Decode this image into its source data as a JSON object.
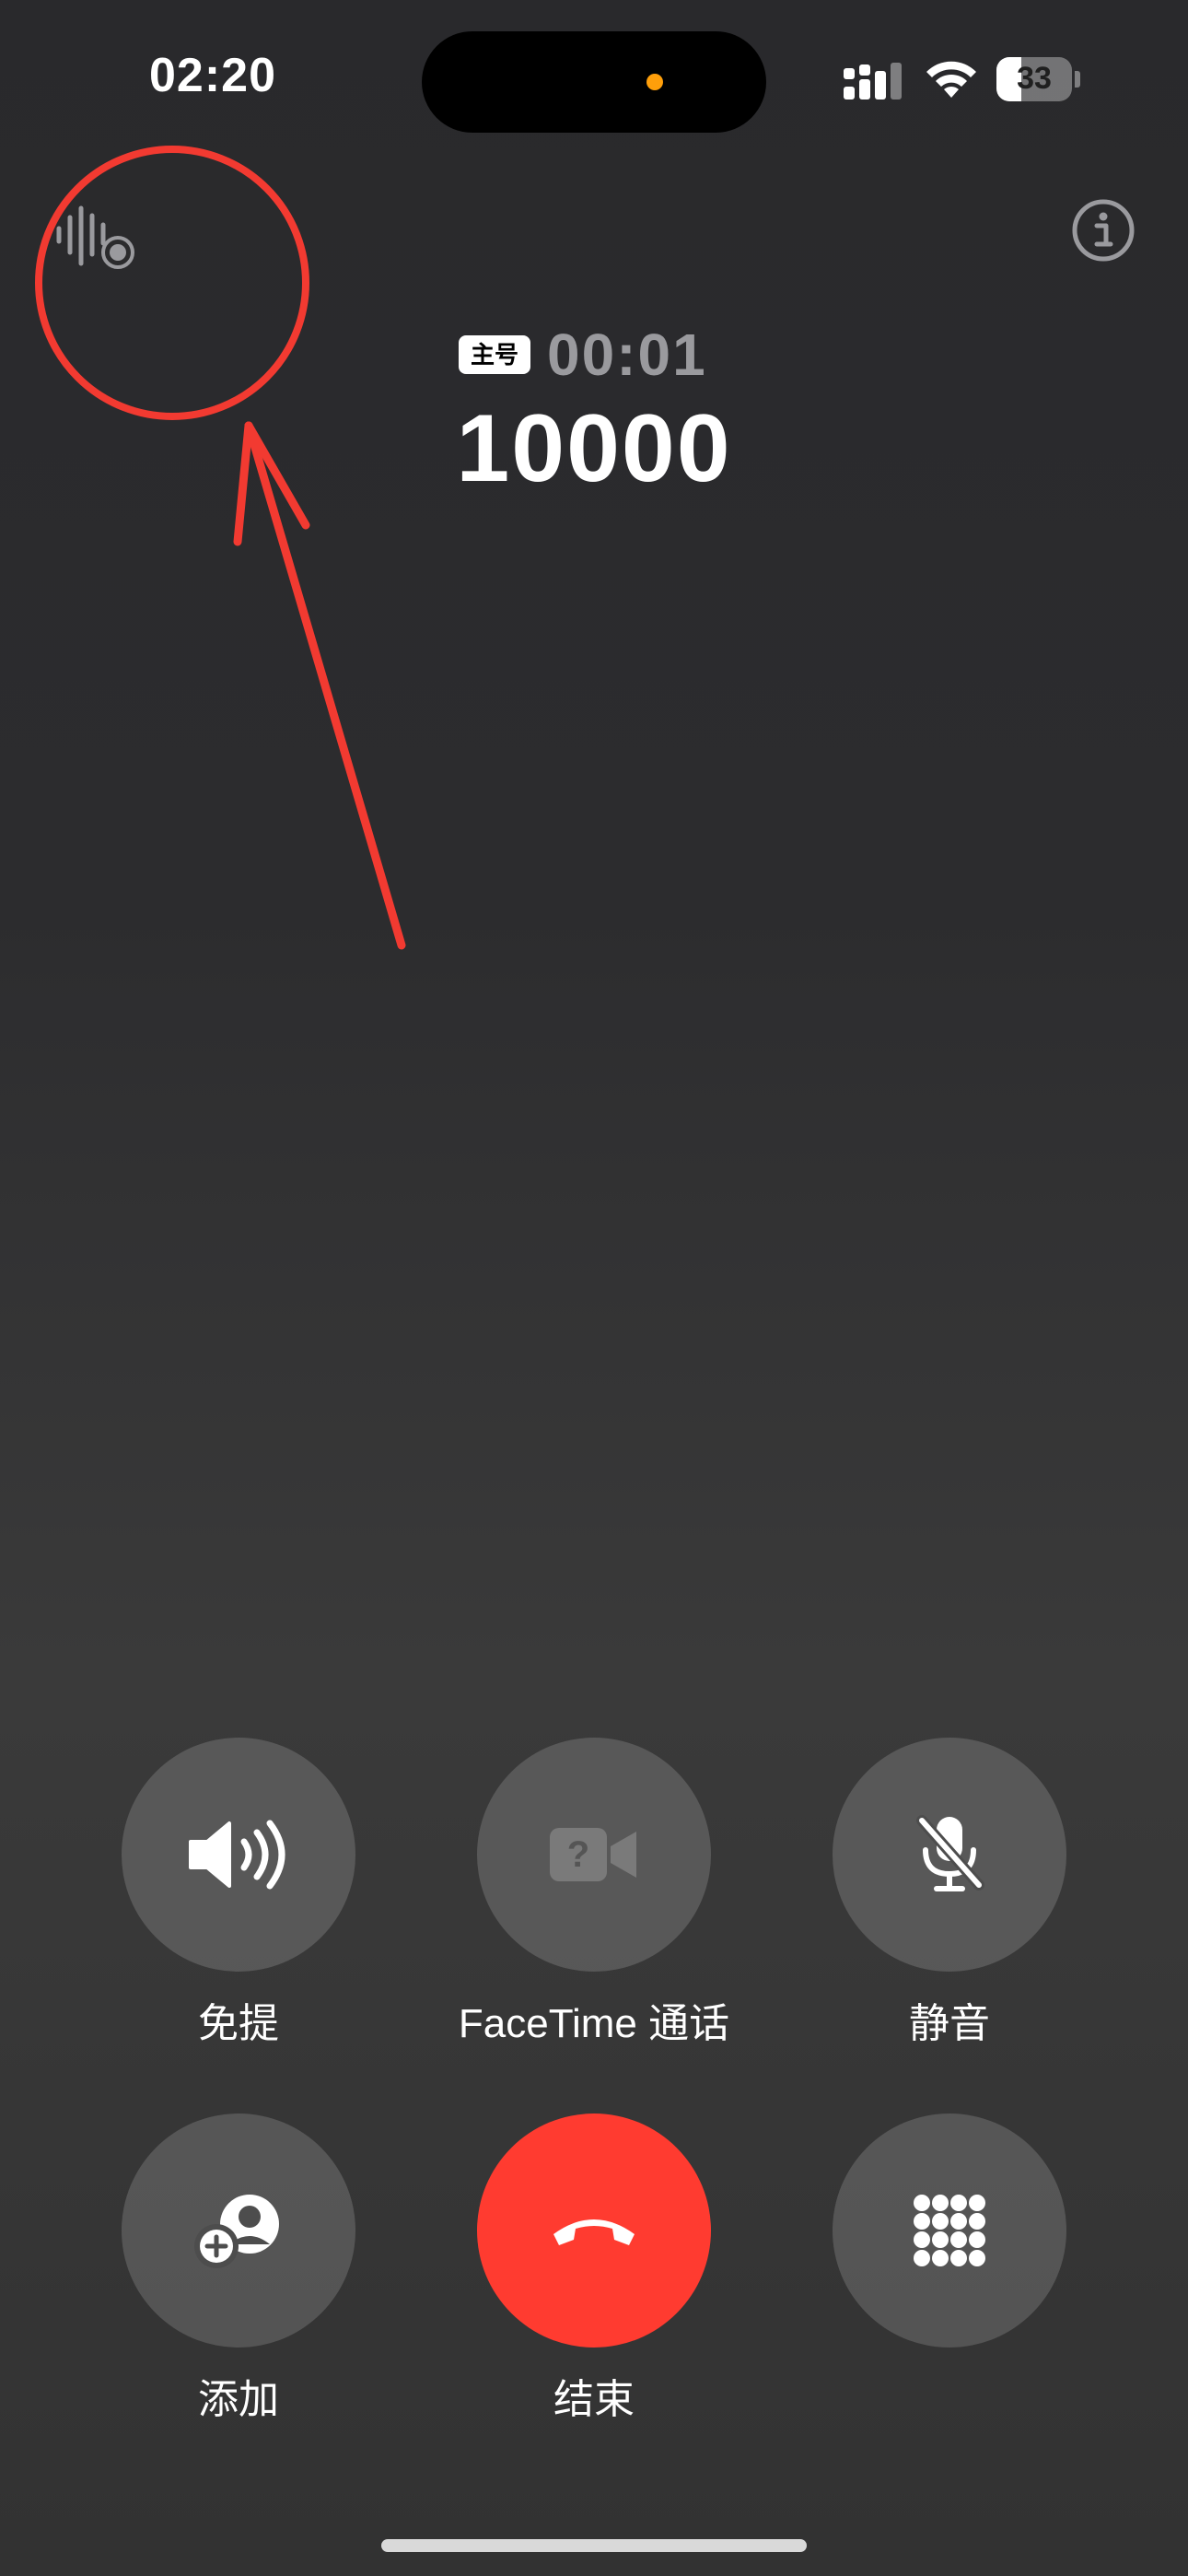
{
  "status_bar": {
    "time": "02:20",
    "battery_percent": "33",
    "battery_level": 0.33,
    "icons": [
      "signal-icon",
      "wifi-icon",
      "battery-icon"
    ],
    "privacy_dot_color": "#ff9f0a"
  },
  "call": {
    "sim_label": "主号",
    "duration": "00:01",
    "number": "10000"
  },
  "controls": [
    {
      "id": "speaker",
      "label": "免提",
      "icon": "speaker-icon"
    },
    {
      "id": "facetime",
      "label": "FaceTime 通话",
      "icon": "facetime-video-icon"
    },
    {
      "id": "mute",
      "label": "静音",
      "icon": "mic-slash-icon"
    },
    {
      "id": "add",
      "label": "添加",
      "icon": "add-person-icon"
    },
    {
      "id": "end",
      "label": "结束",
      "icon": "end-call-icon"
    },
    {
      "id": "keypad",
      "label": "",
      "icon": "keypad-icon"
    }
  ],
  "colors": {
    "end_call": "#ff3b30",
    "annotation": "#f23a31"
  }
}
